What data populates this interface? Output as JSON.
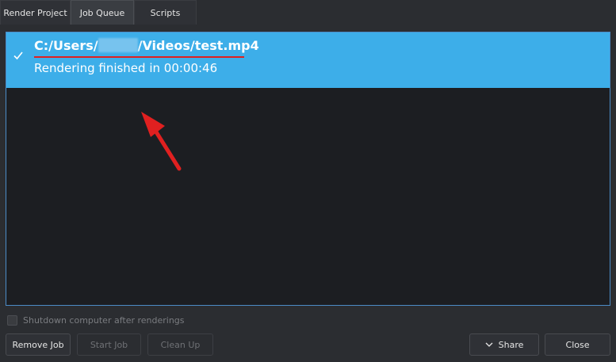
{
  "tabs": [
    {
      "label": "Render Project",
      "active": false
    },
    {
      "label": "Job Queue",
      "active": true
    },
    {
      "label": "Scripts",
      "active": false
    }
  ],
  "job": {
    "path_prefix": "C:/Users/",
    "path_suffix": "/Videos/test.mp4",
    "status": "Rendering finished in 00:00:46",
    "selected": true,
    "status_icon": "check-icon"
  },
  "options": {
    "shutdown_label": "Shutdown computer after renderings",
    "shutdown_checked": false
  },
  "buttons": {
    "remove_job": "Remove Job",
    "start_job": "Start Job",
    "clean_up": "Clean Up",
    "share": "Share",
    "close": "Close"
  },
  "colors": {
    "selection": "#3daee9",
    "annotation": "#e02020"
  }
}
